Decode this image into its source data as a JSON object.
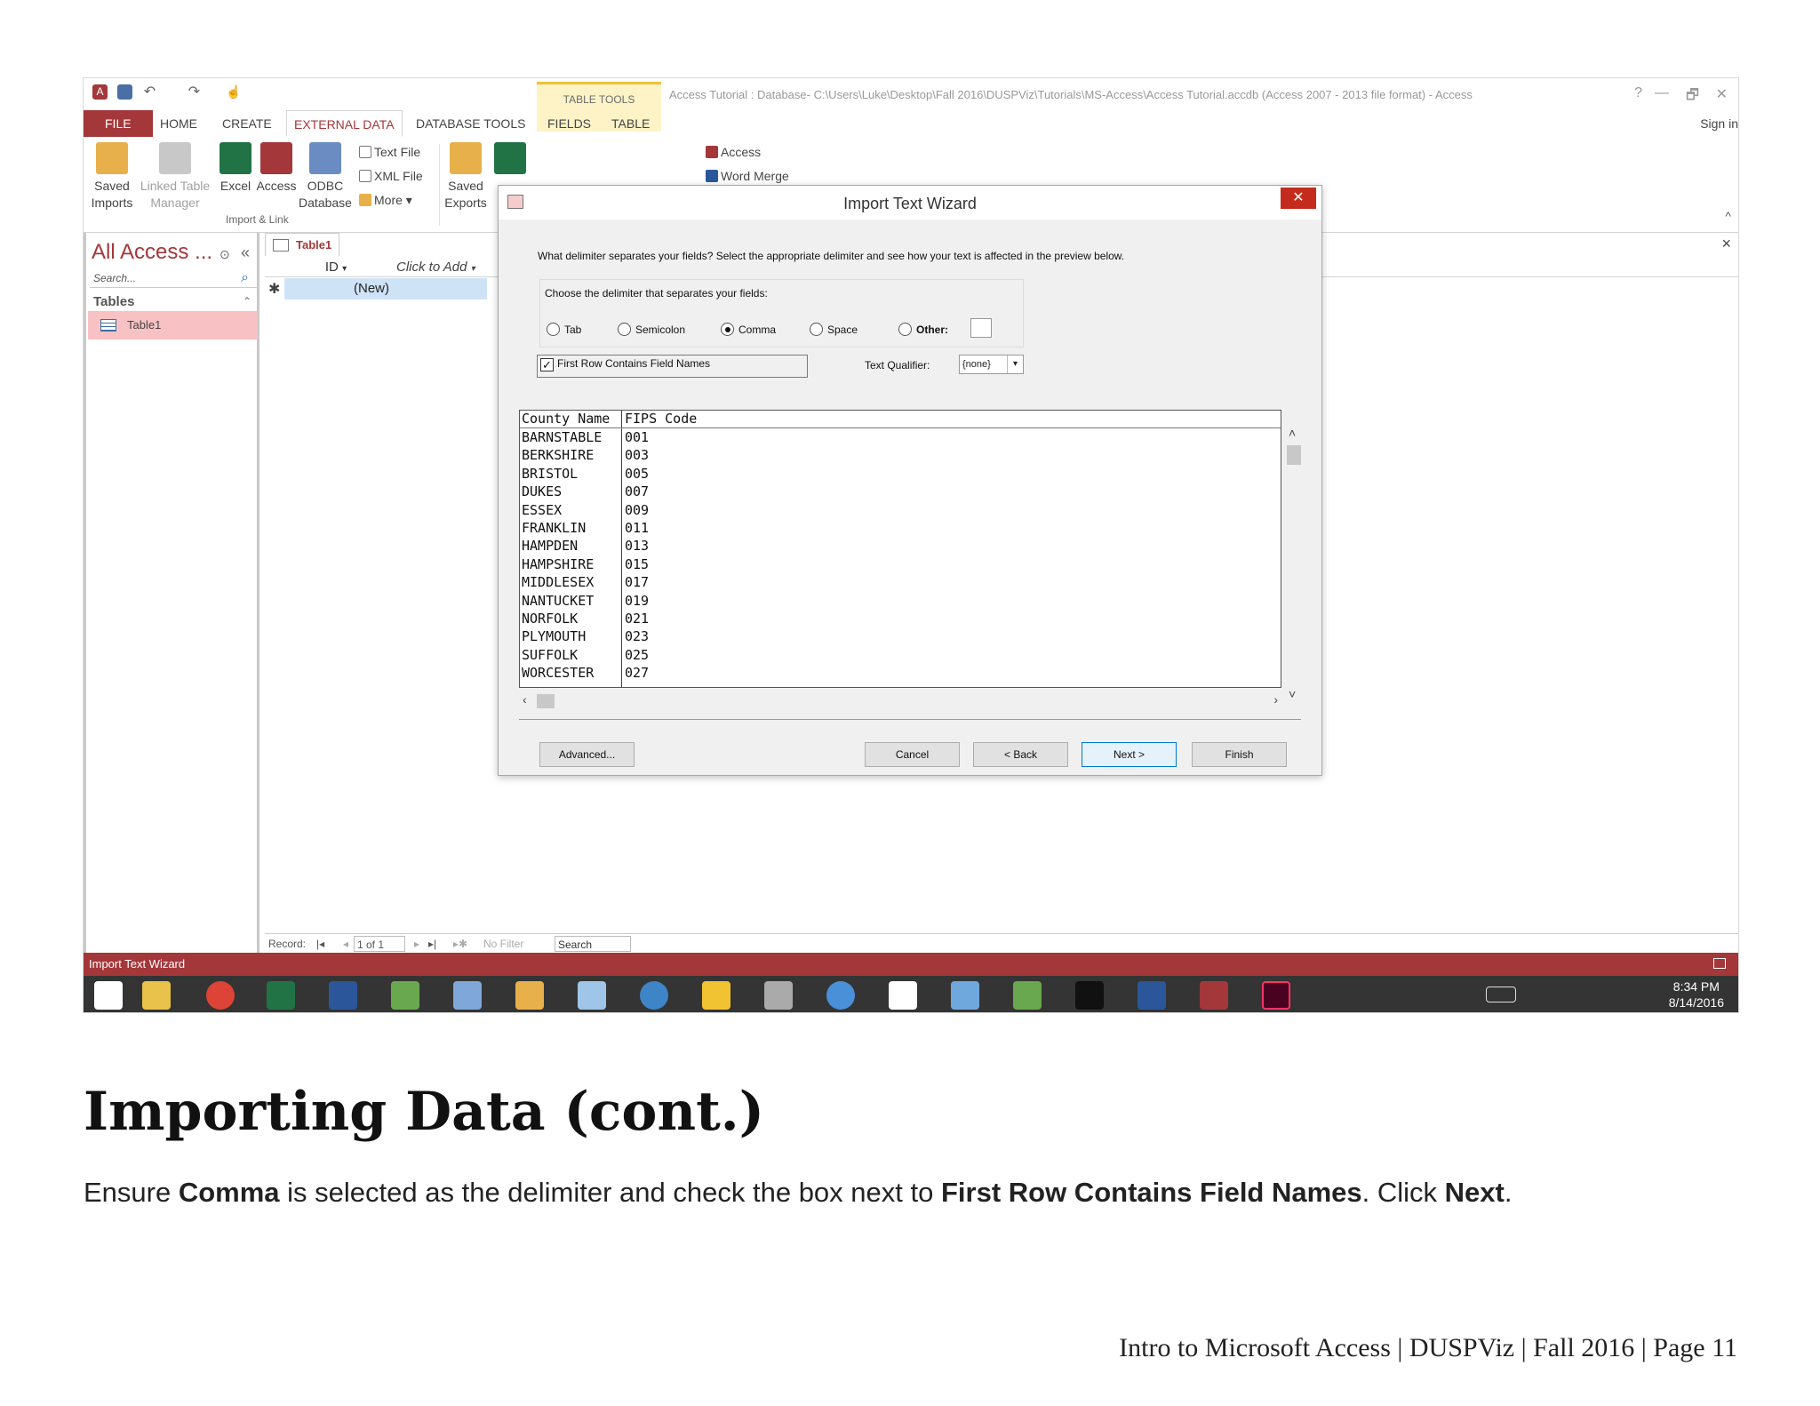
{
  "window": {
    "context_group": "TABLE TOOLS",
    "title": "Access Tutorial : Database- C:\\Users\\Luke\\Desktop\\Fall 2016\\DUSPViz\\Tutorials\\MS-Access\\Access Tutorial.accdb (Access 2007 - 2013 file format) - Access",
    "help": "?",
    "minimize": "—",
    "restore": "🗗",
    "close": "✕",
    "sign_in": "Sign in"
  },
  "tabs": [
    "FILE",
    "HOME",
    "CREATE",
    "EXTERNAL DATA",
    "DATABASE TOOLS",
    "FIELDS",
    "TABLE"
  ],
  "ribbon": {
    "saved_imports": [
      "Saved",
      "Imports"
    ],
    "linked_table_manager": [
      "Linked Table",
      "Manager"
    ],
    "excel": "Excel",
    "access": "Access",
    "odbc": [
      "ODBC",
      "Database"
    ],
    "text_file": "Text File",
    "xml_file": "XML File",
    "more": "More ▾",
    "import_group": "Import & Link",
    "saved_exports": [
      "Saved",
      "Exports"
    ],
    "export_access": "Access",
    "word_merge": "Word Merge",
    "collapse": "^"
  },
  "nav": {
    "header": "All Access ...",
    "search_placeholder": "Search...",
    "group": "Tables",
    "item": "Table1"
  },
  "table": {
    "tab": "Table1",
    "col_id": "ID",
    "col_add": "Click to Add",
    "new_row": "(New)",
    "close": "×",
    "record_label": "Record:",
    "record_pos": "1 of 1",
    "no_filter": "No Filter",
    "search": "Search"
  },
  "statusbar": "Import Text Wizard",
  "clock": {
    "time": "8:34 PM",
    "date": "8/14/2016"
  },
  "dialog": {
    "title": "Import Text Wizard",
    "close": "✕",
    "prompt": "What delimiter separates your fields? Select the appropriate delimiter and see how your text is affected in the preview below.",
    "legend": "Choose the delimiter that separates your fields:",
    "delimiters": [
      {
        "label": "Tab",
        "selected": false
      },
      {
        "label": "Semicolon",
        "selected": false
      },
      {
        "label": "Comma",
        "selected": true
      },
      {
        "label": "Space",
        "selected": false
      },
      {
        "label": "Other:",
        "selected": false
      }
    ],
    "first_row_label": "First Row Contains Field Names",
    "first_row_checked": true,
    "text_qualifier_label": "Text Qualifier:",
    "text_qualifier_value": "{none}",
    "preview_header": [
      "County Name",
      "FIPS Code"
    ],
    "preview_rows": [
      [
        "BARNSTABLE",
        "001"
      ],
      [
        "BERKSHIRE",
        "003"
      ],
      [
        "BRISTOL",
        "005"
      ],
      [
        "DUKES",
        "007"
      ],
      [
        "ESSEX",
        "009"
      ],
      [
        "FRANKLIN",
        "011"
      ],
      [
        "HAMPDEN",
        "013"
      ],
      [
        "HAMPSHIRE",
        "015"
      ],
      [
        "MIDDLESEX",
        "017"
      ],
      [
        "NANTUCKET",
        "019"
      ],
      [
        "NORFOLK",
        "021"
      ],
      [
        "PLYMOUTH",
        "023"
      ],
      [
        "SUFFOLK",
        "025"
      ],
      [
        "WORCESTER",
        "027"
      ]
    ],
    "buttons": {
      "advanced": "Advanced...",
      "cancel": "Cancel",
      "back": "< Back",
      "next": "Next >",
      "finish": "Finish"
    }
  },
  "page": {
    "heading": "Importing Data (cont.)",
    "para": {
      "t1": "Ensure ",
      "b1": "Comma",
      "t2": " is selected as the delimiter and check the box next to ",
      "b2": "First Row Contains Field Names",
      "t3": ". Click ",
      "b3": "Next",
      "t4": "."
    },
    "footer": "Intro to Microsoft Access | DUSPViz | Fall 2016 | Page 11"
  },
  "colors": {
    "access_red": "#a4373a",
    "selection_pink": "#f8c2c4",
    "taskbar": "#343434"
  }
}
